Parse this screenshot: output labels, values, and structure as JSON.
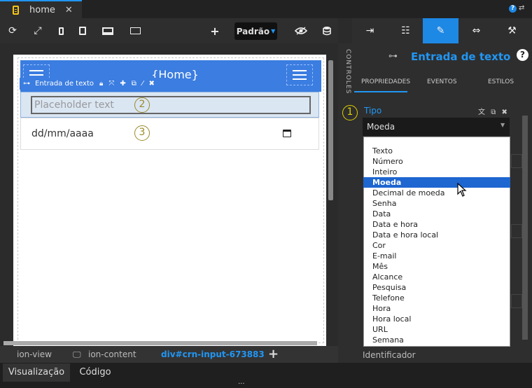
{
  "tabs": {
    "home_label": "home",
    "close_symbol": "✕"
  },
  "toolbar": {
    "padrao_label": "Padrão",
    "icons": [
      "refresh-icon",
      "fullscreen-icon",
      "phone-icon",
      "tablet-icon",
      "desktop-icon",
      "monitor-icon",
      "plus-icon",
      "eye-icon",
      "database-icon"
    ]
  },
  "canvas": {
    "header_title": "{Home}",
    "selection_label": "Entrada de texto",
    "input_placeholder": "Placeholder text",
    "date_placeholder": "dd/mm/aaaa",
    "markers": [
      "1",
      "2",
      "3"
    ]
  },
  "breadcrumb": {
    "items": [
      "ion-view",
      "ion-content",
      "div#crn-input-673883"
    ],
    "add": "+"
  },
  "bottom_tabs": {
    "visualizacao": "Visualização",
    "codigo": "Código",
    "dots": "..."
  },
  "side_strip": {
    "label": "CONTROLES"
  },
  "panel": {
    "title": "Entrada de texto",
    "help": "?",
    "subtabs": [
      "PROPRIEDADES",
      "EVENTOS",
      "ESTILOS"
    ],
    "tipo_label": "Tipo",
    "tipo_value": "Moeda",
    "identificador_label": "Identificador"
  },
  "dropdown_options": [
    "Texto",
    "Número",
    "Inteiro",
    "Moeda",
    "Decimal de moeda",
    "Senha",
    "Data",
    "Data e hora",
    "Data e hora local",
    "Cor",
    "E-mail",
    "Mês",
    "Alcance",
    "Pesquisa",
    "Telefone",
    "Hora",
    "Hora local",
    "URL",
    "Semana"
  ],
  "dropdown_selected": "Moeda",
  "colors": {
    "accent": "#2196f3",
    "header": "#3b7de0",
    "selected": "#1e66d0"
  }
}
